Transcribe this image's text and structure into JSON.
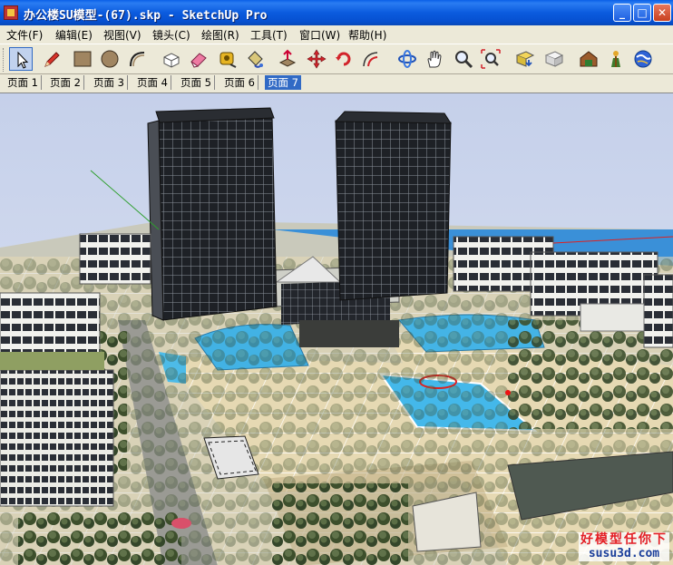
{
  "window": {
    "title": "办公楼SU模型-(67).skp - SketchUp Pro",
    "buttons": {
      "minimize": "_",
      "maximize": "□",
      "close": "✕"
    }
  },
  "menu": [
    {
      "label": "文件(F)"
    },
    {
      "label": "编辑(E)"
    },
    {
      "label": "视图(V)"
    },
    {
      "label": "镜头(C)"
    },
    {
      "label": "绘图(R)"
    },
    {
      "label": "工具(T)"
    },
    {
      "label": "窗口(W)"
    },
    {
      "label": "帮助(H)"
    }
  ],
  "toolbar": {
    "tools": [
      {
        "name": "select-tool",
        "icon": "arrow-cursor-icon",
        "active": true
      },
      {
        "name": "line-tool",
        "icon": "pencil-icon"
      },
      {
        "name": "rectangle-tool",
        "icon": "rectangle-icon"
      },
      {
        "name": "circle-tool",
        "icon": "circle-icon"
      },
      {
        "name": "arc-tool",
        "icon": "arc-icon"
      },
      {
        "name": "make-component-tool",
        "icon": "component-icon"
      },
      {
        "name": "eraser-tool",
        "icon": "eraser-icon"
      },
      {
        "name": "tape-measure-tool",
        "icon": "tape-measure-icon"
      },
      {
        "name": "paint-bucket-tool",
        "icon": "paint-bucket-icon"
      },
      {
        "name": "push-pull-tool",
        "icon": "push-pull-icon"
      },
      {
        "name": "move-tool",
        "icon": "move-icon"
      },
      {
        "name": "rotate-tool",
        "icon": "rotate-icon"
      },
      {
        "name": "offset-tool",
        "icon": "offset-icon"
      },
      {
        "name": "orbit-tool",
        "icon": "orbit-icon"
      },
      {
        "name": "pan-tool",
        "icon": "hand-icon"
      },
      {
        "name": "zoom-tool",
        "icon": "magnifier-icon"
      },
      {
        "name": "zoom-extents-tool",
        "icon": "zoom-extents-icon"
      },
      {
        "name": "previous-view-tool",
        "icon": "previous-view-icon"
      },
      {
        "name": "next-view-tool",
        "icon": "next-view-icon"
      },
      {
        "name": "get-models-tool",
        "icon": "warehouse-icon"
      },
      {
        "name": "share-model-tool",
        "icon": "share-icon"
      },
      {
        "name": "google-earth-tool",
        "icon": "globe-icon"
      }
    ]
  },
  "scene_tabs": [
    {
      "label": "页面 1"
    },
    {
      "label": "页面 2"
    },
    {
      "label": "页面 3"
    },
    {
      "label": "页面 4"
    },
    {
      "label": "页面 5"
    },
    {
      "label": "页面 6"
    },
    {
      "label": "页面 7",
      "active": true
    }
  ],
  "watermark": {
    "line1": "好模型任你下",
    "line2": "susu3d.com"
  },
  "colors": {
    "titlebar": "#0b5bde",
    "chrome": "#ece9d8",
    "active_tab": "#316ac5",
    "sky": "#cfd8ee",
    "water": "#3fb0e6",
    "building_glass": "#1e2126",
    "plaza": "#e6d9b3"
  }
}
